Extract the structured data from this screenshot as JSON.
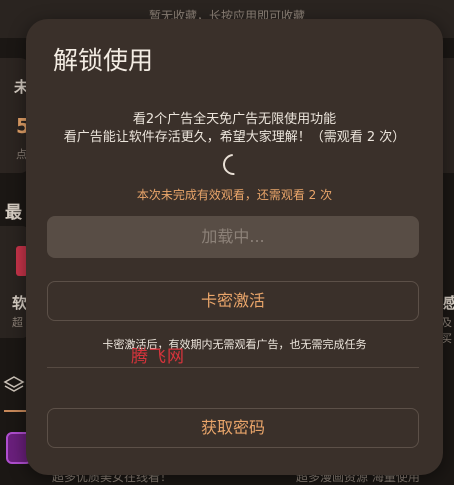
{
  "background": {
    "top_text": "暂无收藏，长按应用即可收藏",
    "left_glyphs": [
      "未",
      "5",
      "点",
      "最",
      "软",
      "超"
    ],
    "right_glyphs": [
      "感",
      "及买"
    ],
    "bottom_left_text": "超多优质美女在线看！",
    "bottom_right_text": "超多漫画资源 海量使用"
  },
  "dialog": {
    "title": "解锁使用",
    "message_line1": "看2个广告全天免广告无限使用功能",
    "message_line2": "看广告能让软件存活更久，希望大家理解！（需观看 2 次）",
    "warning": "本次未完成有效观看，还需观看 2 次",
    "loading_button": "加载中...",
    "activate_button": "卡密激活",
    "note": "卡密激活后，有效期内无需观看广告，也无需完成任务",
    "watermark": "腾飞网",
    "get_password_button": "获取密码"
  },
  "colors": {
    "dialog_bg": "#3a302a",
    "accent": "#e9a56a",
    "watermark": "#d6343c"
  }
}
